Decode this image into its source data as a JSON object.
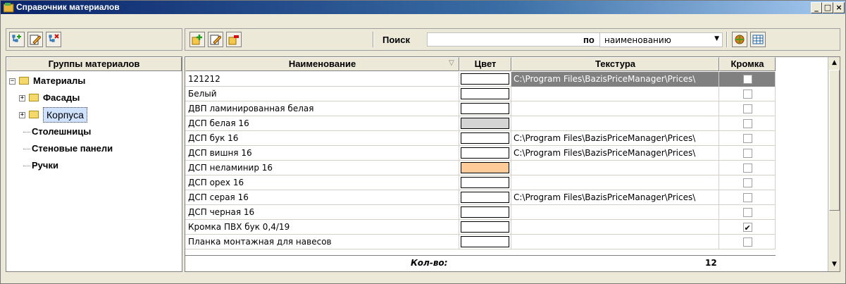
{
  "window": {
    "title": "Справочник материалов",
    "minimize": "_",
    "maximize": "□",
    "close": "×"
  },
  "left_panel": {
    "header": "Группы материалов",
    "tree": [
      {
        "label": "Материалы",
        "level": 0,
        "expander": "−",
        "folder": "open"
      },
      {
        "label": "Фасады",
        "level": 1,
        "expander": "+",
        "folder": "closed"
      },
      {
        "label": "Корпуса",
        "level": 1,
        "expander": "+",
        "folder": "closed",
        "selected": true
      },
      {
        "label": "Столешницы",
        "level": 1,
        "expander": "",
        "folder": ""
      },
      {
        "label": "Стеновые панели",
        "level": 1,
        "expander": "",
        "folder": ""
      },
      {
        "label": "Ручки",
        "level": 1,
        "expander": "",
        "folder": ""
      }
    ]
  },
  "search": {
    "label": "Поиск",
    "value": "",
    "by_label": "по",
    "by_value": "наименованию"
  },
  "grid": {
    "columns": [
      "Наименование",
      "Цвет",
      "Текстура",
      "Кромка"
    ],
    "rows": [
      {
        "name": "121212",
        "color": "#ffffff",
        "texture": "C:\\Program Files\\BazisPriceManager\\Prices\\",
        "edge": false,
        "selected": true
      },
      {
        "name": "Белый",
        "color": "#ffffff",
        "texture": "",
        "edge": false
      },
      {
        "name": "ДВП ламинированная белая",
        "color": "#ffffff",
        "texture": "",
        "edge": false
      },
      {
        "name": "ДСП белая 16",
        "color": "#d4d4d4",
        "texture": "",
        "edge": false
      },
      {
        "name": "ДСП бук 16",
        "color": "#ffffff",
        "texture": "C:\\Program Files\\BazisPriceManager\\Prices\\",
        "edge": false
      },
      {
        "name": "ДСП вишня 16",
        "color": "#ffffff",
        "texture": "C:\\Program Files\\BazisPriceManager\\Prices\\",
        "edge": false
      },
      {
        "name": "ДСП неламинир 16",
        "color": "#ffcc99",
        "texture": "",
        "edge": false
      },
      {
        "name": "ДСП орех 16",
        "color": "#ffffff",
        "texture": "",
        "edge": false
      },
      {
        "name": "ДСП серая 16",
        "color": "#ffffff",
        "texture": "C:\\Program Files\\BazisPriceManager\\Prices\\",
        "edge": false
      },
      {
        "name": "ДСП черная 16",
        "color": "#ffffff",
        "texture": "",
        "edge": false
      },
      {
        "name": "Кромка ПВХ бук 0,4/19",
        "color": "#ffffff",
        "texture": "",
        "edge": true
      },
      {
        "name": "Планка монтажная для навесов",
        "color": "#ffffff",
        "texture": "",
        "edge": false
      }
    ],
    "footer": {
      "label": "Кол-во:",
      "count": "12"
    }
  }
}
